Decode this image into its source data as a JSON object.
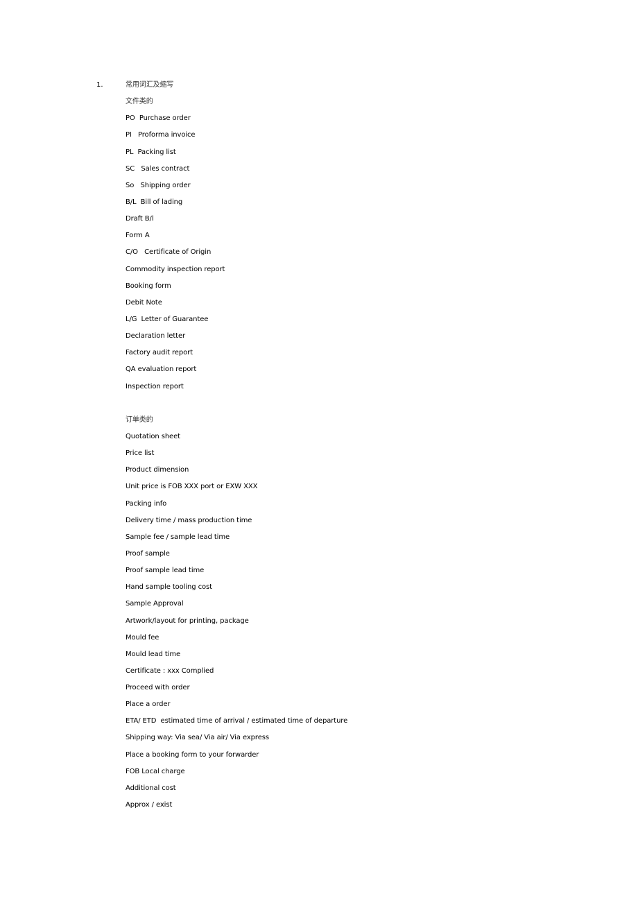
{
  "section": {
    "number": "1.",
    "title": "常用词汇及缩写"
  },
  "groups": [
    {
      "heading": "文件类的",
      "items": [
        "PO  Purchase order",
        "PI   Proforma invoice",
        "PL  Packing list",
        "SC   Sales contract",
        "So   Shipping order",
        "B/L  Bill of lading",
        "Draft B/l",
        "Form A",
        "C/O   Certificate of Origin",
        "Commodity inspection report",
        "Booking form",
        "Debit Note",
        "L/G  Letter of Guarantee",
        "Declaration letter",
        "Factory audit report",
        "QA evaluation report",
        "Inspection report"
      ]
    },
    {
      "heading": "订单类的",
      "items": [
        "Quotation sheet",
        "Price list",
        "Product dimension",
        "Unit price is FOB XXX port or EXW XXX",
        "Packing info",
        "Delivery time / mass production time",
        "Sample fee / sample lead time",
        "Proof sample",
        "Proof sample lead time",
        "Hand sample tooling cost",
        "Sample Approval",
        "Artwork/layout for printing, package",
        "Mould fee",
        "Mould lead time",
        "Certificate : xxx Complied",
        "Proceed with order",
        "Place a order",
        "ETA/ ETD  estimated time of arrival / estimated time of departure",
        "Shipping way: Via sea/ Via air/ Via express",
        "Place a booking form to your forwarder",
        "FOB Local charge",
        "Additional cost",
        "Approx / exist"
      ]
    }
  ]
}
